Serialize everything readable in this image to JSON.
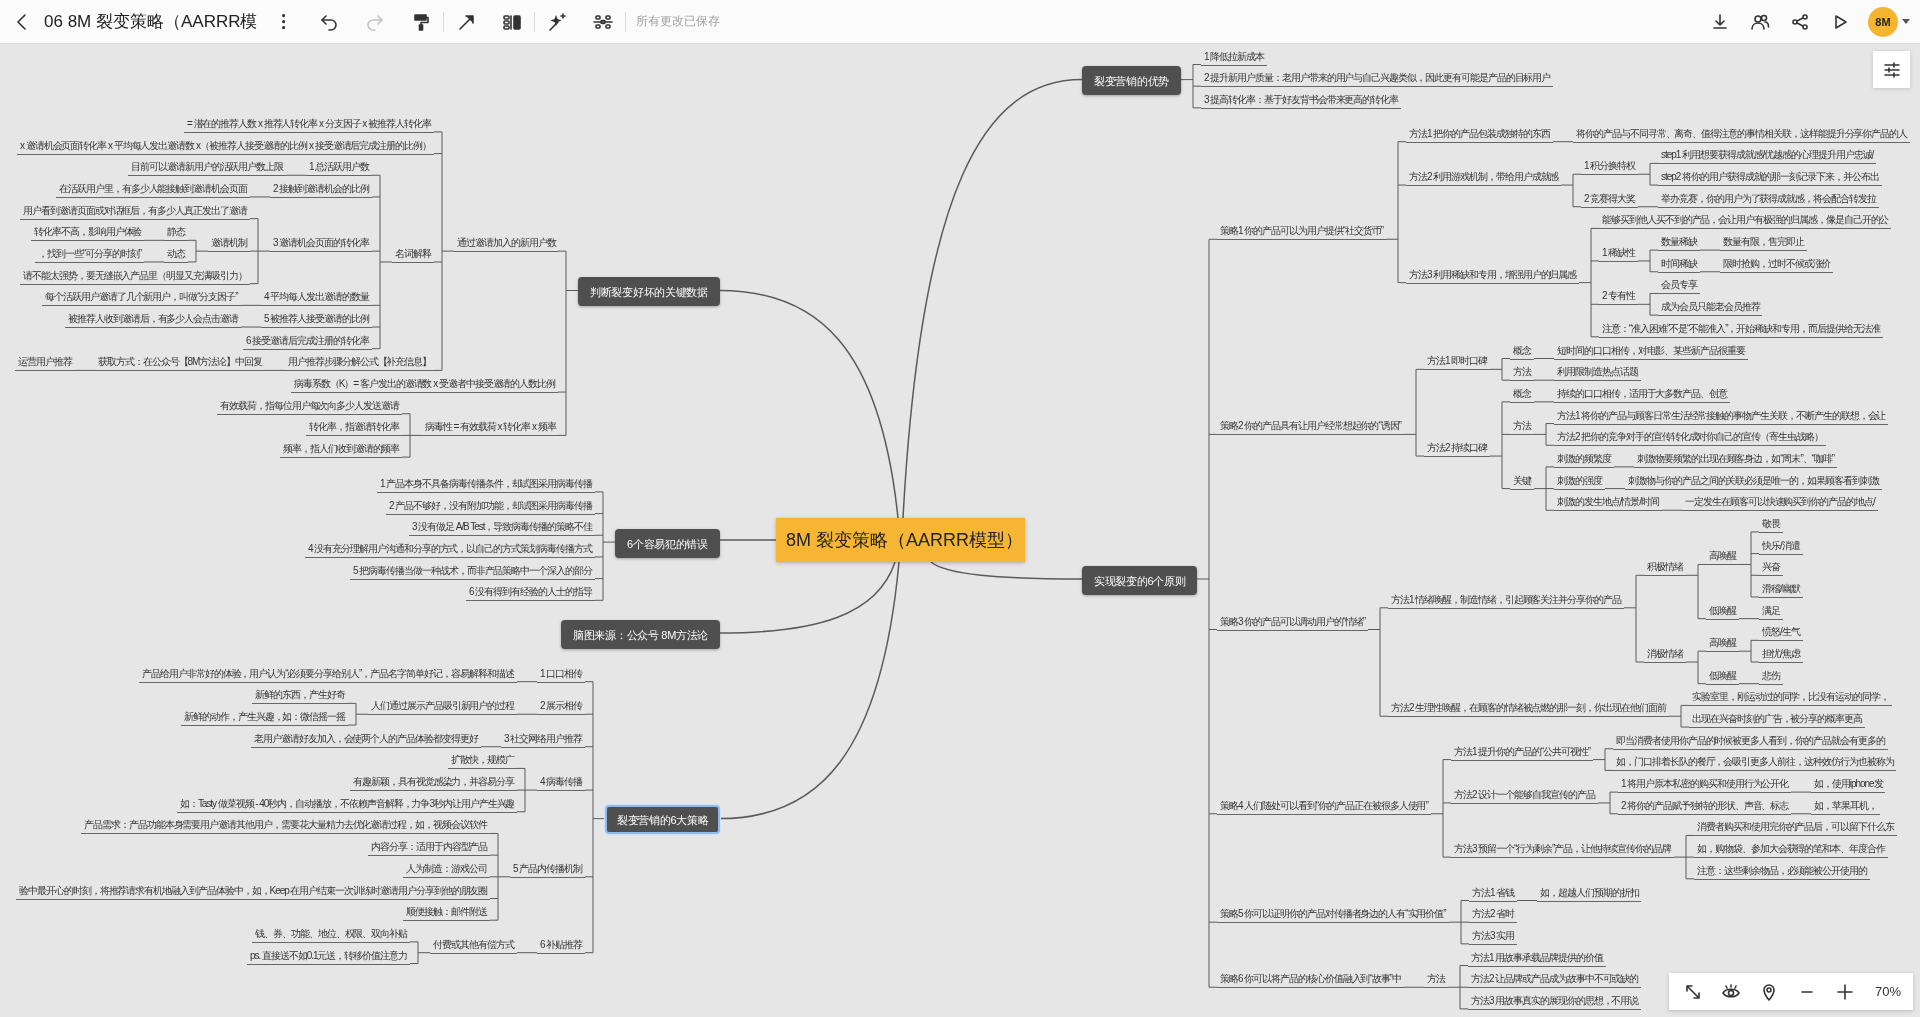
{
  "toolbar": {
    "nav": [
      {
        "kind": "back",
        "disabled": false
      }
    ],
    "title": "06 8M 裂变策略（AARRR模",
    "tool_groups": [
      [
        {
          "kind": "more",
          "disabled": false
        },
        {
          "kind": "undo",
          "disabled": false
        },
        {
          "kind": "redo",
          "disabled": true
        },
        {
          "kind": "painter",
          "disabled": false
        }
      ],
      [
        {
          "kind": "relationship",
          "disabled": false
        },
        {
          "kind": "summary",
          "disabled": false
        }
      ],
      [
        {
          "kind": "magic",
          "disabled": false
        },
        {
          "kind": "structure",
          "disabled": false
        }
      ]
    ],
    "status": "所有更改已保存",
    "right_tools": [
      {
        "kind": "download",
        "disabled": false
      },
      {
        "kind": "collaborate",
        "disabled": false
      },
      {
        "kind": "share",
        "disabled": false
      },
      {
        "kind": "play",
        "disabled": false
      }
    ],
    "avatar": "8M"
  },
  "mind_map": {
    "central_topic": "8M 裂变策略（AARRR模型）",
    "branches": [
      {
        "label": "裂变营销的优势",
        "selected": false,
        "children": [
          {
            "text": "1 降低拉新成本"
          },
          {
            "text": "2 提升新用户质量：老用户带来的用户与自己兴趣类似，因此更有可能是产品的目标用户"
          },
          {
            "text": "3 提高转化率：基于好友背书会带来更高的转化率"
          }
        ]
      },
      {
        "label": "判断裂变好坏的关键数据",
        "selected": false,
        "children": [
          {
            "text": "通过邀请加入的新用户数",
            "children": [
              {
                "text": "= 潜在的推荐人数 x 推荐人转化率 x 分支因子 x 被推荐人转化率"
              },
              {
                "text": "x 邀请机会页面转化率 x 平均每人发出邀请数 x（被推荐人接受邀请的比例 x 接受邀请后完成注册的比例）"
              },
              {
                "text": "名词解释",
                "children": [
                  {
                    "text": "1 总活跃用户数",
                    "children": [
                      {
                        "text": "目前可以邀请新用户的活跃用户数上限"
                      }
                    ]
                  },
                  {
                    "text": "2 接触到邀请机会的比例",
                    "children": [
                      {
                        "text": "在活跃用户里，有多少人能接触到邀请机会页面"
                      }
                    ]
                  },
                  {
                    "text": "3 邀请机会页面的转化率",
                    "children": [
                      {
                        "text": "用户看到邀请页面或对话框后，有多少人真正发出了邀请"
                      },
                      {
                        "text": "邀请机制",
                        "children": [
                          {
                            "text": "静态",
                            "children": [
                              {
                                "text": "转化率不高，影响用户体验"
                              }
                            ]
                          },
                          {
                            "text": "动态",
                            "children": [
                              {
                                "text": "，找到一些“可分享的时刻”"
                              }
                            ]
                          }
                        ]
                      },
                      {
                        "text": "请不能太强势，要无缝嵌入产品里（明显又充满吸引力）"
                      }
                    ]
                  },
                  {
                    "text": "4 平均每人发出邀请的数量",
                    "children": [
                      {
                        "text": "每个活跃用户邀请了几个新用户，叫做“分支因子”"
                      }
                    ]
                  },
                  {
                    "text": "5 被推荐人接受邀请的比例",
                    "children": [
                      {
                        "text": "被推荐人收到邀请后，有多少人会点击邀请"
                      }
                    ]
                  },
                  {
                    "text": "6 接受邀请后完成注册的转化率"
                  }
                ]
              },
              {
                "text": "用户推荐步骤分解公式【补充信息】",
                "children": [
                  {
                    "text": "获取方式：在公众号【8M方法论】中回复",
                    "children": [
                      {
                        "text": "运营用户推荐"
                      }
                    ]
                  }
                ]
              }
            ]
          },
          {
            "text": "病毒系数（K）= 客户发出的邀请数 x 受邀者中接受邀请的人数比例"
          },
          {
            "text": "病毒性 = 有效载荷 x 转化率 x 频率",
            "children": [
              {
                "text": "有效载荷，指每位用户每次向多少人发送邀请"
              },
              {
                "text": "转化率，指邀请转化率"
              },
              {
                "text": "频率，指人们收到邀请的频率"
              }
            ]
          }
        ]
      },
      {
        "label": "6个容易犯的错误",
        "selected": false,
        "children": [
          {
            "text": "1 产品本身不具备病毒传播条件，却试图采用病毒传播"
          },
          {
            "text": "2 产品不够好，没有附加功能，却试图采用病毒传播"
          },
          {
            "text": "3 没有做足 A/B Test，导致病毒传播的策略不佳"
          },
          {
            "text": "4 没有充分理解用户沟通和分享的方式，以自己的方式策划病毒传播方式"
          },
          {
            "text": "5 把病毒传播当做一种战术，而非产品策略中一个深入的部分"
          },
          {
            "text": "6 没有得到有经验的人士的指导"
          }
        ]
      },
      {
        "label": "实现裂变的6个原则",
        "selected": false,
        "children": [
          {
            "text": "策略1 你的产品可以为用户提供“社交货币”",
            "children": [
              {
                "text": "方法1 把你的产品包装成独特的东西",
                "children": [
                  {
                    "text": "将你的产品与不同寻常、离奇、值得注意的事情相关联，这样能提升分享你产品的人"
                  }
                ]
              },
              {
                "text": "方法2 利用游戏机制，带给用户成就感",
                "children": [
                  {
                    "text": "1 积分换特权",
                    "children": [
                      {
                        "text": "step1 利用想要获得成就感/优越感的心理提升用户忠诚/"
                      },
                      {
                        "text": "step2 将你的用户获得成就的那一刻记录下来，并公布出"
                      }
                    ]
                  },
                  {
                    "text": "2 竞赛得大奖",
                    "children": [
                      {
                        "text": "举办竞赛，你的用户为了获得成就感，将会配合转发拉"
                      }
                    ]
                  }
                ]
              },
              {
                "text": "方法3 利用稀缺和专用，增强用户的归属感",
                "children": [
                  {
                    "text": "能够买到他人买不到的产品，会让用户有极强的归属感，像是自己开的公"
                  },
                  {
                    "text": "1 稀缺性",
                    "children": [
                      {
                        "text": "数量稀缺",
                        "children": [
                          {
                            "text": "数量有限，售完即止"
                          }
                        ]
                      },
                      {
                        "text": "时间稀缺",
                        "children": [
                          {
                            "text": "限时抢购，过时不候或涨价"
                          }
                        ]
                      }
                    ]
                  },
                  {
                    "text": "2 专有性",
                    "children": [
                      {
                        "text": "会员专享"
                      },
                      {
                        "text": "成为会员只能老会员推荐"
                      }
                    ]
                  },
                  {
                    "text": "注意：“准入困难”不是“不能准入”，开始稀缺和专用，而后提供给无法准"
                  }
                ]
              }
            ]
          },
          {
            "text": "策略2 你的产品具有让用户经常想起你的“诱因”",
            "children": [
              {
                "text": "方法1 即时口碑",
                "children": [
                  {
                    "text": "概念",
                    "children": [
                      {
                        "text": "短时间的口口相传，对电影、某些新产品很重要"
                      }
                    ]
                  },
                  {
                    "text": "方法",
                    "children": [
                      {
                        "text": "利用限制造热点话题"
                      }
                    ]
                  }
                ]
              },
              {
                "text": "方法2 持续口碑",
                "children": [
                  {
                    "text": "概念",
                    "children": [
                      {
                        "text": "持续的口口相传，适用于大多数产品、创意"
                      }
                    ]
                  },
                  {
                    "text": "方法",
                    "children": [
                      {
                        "text": "方法1 将你的产品与顾客日常生活经常接触的事物产生关联，不断产生的联想，会让"
                      },
                      {
                        "text": "方法2 把你的竞争对手的宣传转化成对你自己的宣传（寄生虫战略）"
                      }
                    ]
                  },
                  {
                    "text": "关键",
                    "children": [
                      {
                        "text": "刺激的频繁度",
                        "children": [
                          {
                            "text": "刺激物要频繁的出现在顾客身边，如“周末”、“咖啡”"
                          }
                        ]
                      },
                      {
                        "text": "刺激的强度",
                        "children": [
                          {
                            "text": "刺激物与你的产品之间的关联必须是唯一的，如果顾客看到刺激"
                          }
                        ]
                      },
                      {
                        "text": "刺激的发生地点/情景/时间",
                        "children": [
                          {
                            "text": "一定发生在顾客可以快速购买到你的产品的地点/"
                          }
                        ]
                      }
                    ]
                  }
                ]
              }
            ]
          },
          {
            "text": "策略3 你的产品可以调动用户的“情绪”",
            "children": [
              {
                "text": "方法1 情绪唤醒，制造情绪，引起顾客关注并分享你的产品",
                "children": [
                  {
                    "text": "积极情绪",
                    "children": [
                      {
                        "text": "高唤醒",
                        "children": [
                          {
                            "text": "敬畏"
                          },
                          {
                            "text": "快乐/消遣"
                          },
                          {
                            "text": "兴奋"
                          },
                          {
                            "text": "滑稽/幽默"
                          }
                        ]
                      },
                      {
                        "text": "低唤醒",
                        "children": [
                          {
                            "text": "满足"
                          }
                        ]
                      }
                    ]
                  },
                  {
                    "text": "消极情绪",
                    "children": [
                      {
                        "text": "高唤醒",
                        "children": [
                          {
                            "text": "愤怒/生气"
                          },
                          {
                            "text": "担忧/焦虑"
                          }
                        ]
                      },
                      {
                        "text": "低唤醒",
                        "children": [
                          {
                            "text": "悲伤"
                          }
                        ]
                      }
                    ]
                  }
                ]
              },
              {
                "text": "方法2 生理性唤醒，在顾客的情绪被点燃的那一刻，你出现在他们面前",
                "children": [
                  {
                    "text": "实验室里，刚运动过的同学，比没有运动的同学，"
                  },
                  {
                    "text": "出现在兴奋时刻的广告，被分享的概率更高"
                  }
                ]
              }
            ]
          },
          {
            "text": "策略4 人们随处可以看到“你的产品正在被很多人使用”",
            "children": [
              {
                "text": "方法1 提升你的产品的“公共可视性”",
                "children": [
                  {
                    "text": "即当消费者使用你产品的时候被更多人看到，你的产品就会有更多的"
                  },
                  {
                    "text": "如，门口排着长队的餐厅，会吸引更多人前往，这种效仿行为也被称为"
                  }
                ]
              },
              {
                "text": "方法2 设计一个能够自我宣传的产品",
                "children": [
                  {
                    "text": "1 将用户原本私密的购买和使用行为公开化",
                    "children": [
                      {
                        "text": "如，使用iphone发"
                      }
                    ]
                  },
                  {
                    "text": "2 将你的产品赋予独特的形状、声音、标志",
                    "children": [
                      {
                        "text": "如，苹果耳机，"
                      }
                    ]
                  }
                ]
              },
              {
                "text": "方法3 预留一个“行为剩余”产品，让他持续宣传你的品牌",
                "children": [
                  {
                    "text": "消费者购买和使用完你的产品后，可以留下什么东"
                  },
                  {
                    "text": "如，购物袋、参加大会获得的笔和本、年度合作"
                  },
                  {
                    "text": "注意：这些剩余物品，必须能被公开使用的"
                  }
                ]
              }
            ]
          },
          {
            "text": "策略5 你可以证明你的产品对传播者身边的人有“实用价值”",
            "children": [
              {
                "text": "方法1 省钱",
                "children": [
                  {
                    "text": "如，超越人们预期的折扣"
                  }
                ]
              },
              {
                "text": "方法2 省时"
              },
              {
                "text": "方法3 实用"
              }
            ]
          },
          {
            "text": "策略6 你可以将产品的核心价值融入到“故事”中",
            "children": [
              {
                "text": "方法",
                "children": [
                  {
                    "text": "方法1 用故事承载品牌提供的价值"
                  },
                  {
                    "text": "方法2 让品牌或产品成为故事中不可或缺的"
                  },
                  {
                    "text": "方法3 用故事真实的展现你的思想，不用说"
                  }
                ]
              }
            ]
          }
        ]
      },
      {
        "label": "脑图来源：公众号 8M方法论",
        "selected": false
      },
      {
        "label": "裂变营销的6大策略",
        "selected": true,
        "children": [
          {
            "text": "1 口口相传",
            "children": [
              {
                "text": "产品给用户非常好的体验，用户认为“必须要分享给别人”，产品名字简单好记，容易解释和描述"
              }
            ]
          },
          {
            "text": "2 展示相传",
            "children": [
              {
                "text": "人们通过展示产品吸引新用户的过程",
                "children": [
                  {
                    "text": "新鲜的东西，产生好奇"
                  },
                  {
                    "text": "新鲜的动作，产生兴趣，如：微信摇一摇"
                  }
                ]
              }
            ]
          },
          {
            "text": "3 社交网络用户推荐",
            "children": [
              {
                "text": "老用户邀请好友加入，会使两个人的产品体验都变得更好"
              }
            ]
          },
          {
            "text": "4 病毒传播",
            "children": [
              {
                "text": "扩散快，规模广"
              },
              {
                "text": "有趣新颖，具有视觉感染力，并容易分享"
              },
              {
                "text": "如：Tasty 做菜视频 - 40秒内，自动播放，不依赖声音解释，力争3秒内让用户产生兴趣"
              }
            ]
          },
          {
            "text": "5 产品内传播机制",
            "children": [
              {
                "text": "产品需求：产品功能本身需要用户邀请其他用户，需要花大量精力去优化邀请过程，如，视频会议软件"
              },
              {
                "text": "内容分享：适用于内容型产品"
              },
              {
                "text": "人为制造：游戏公司"
              },
              {
                "text": "验中最开心的时刻，将推荐请求有机地融入到产品体验中，如，Keep 在用户结束一次训练时邀请用户分享到他的朋友圈"
              },
              {
                "text": "顺便接触：邮件附送"
              }
            ]
          },
          {
            "text": "6 补贴推荐",
            "children": [
              {
                "text": "付费或其他有偿方式",
                "children": [
                  {
                    "text": "钱、券、功能、地位、权限、双向补贴"
                  },
                  {
                    "text": "ps. 直接送不如0.1元送，转移价值注意力"
                  }
                ]
              }
            ]
          }
        ]
      }
    ]
  },
  "zoom_bar": {
    "tools": [
      {
        "kind": "fit",
        "disabled": false
      },
      {
        "kind": "view",
        "disabled": false
      },
      {
        "kind": "locate",
        "disabled": false
      },
      {
        "kind": "zoom_out",
        "disabled": false
      },
      {
        "kind": "zoom_in",
        "disabled": false
      }
    ],
    "zoom": "70%"
  },
  "side_panel": {
    "tools": [
      {
        "kind": "format",
        "disabled": false
      }
    ]
  }
}
